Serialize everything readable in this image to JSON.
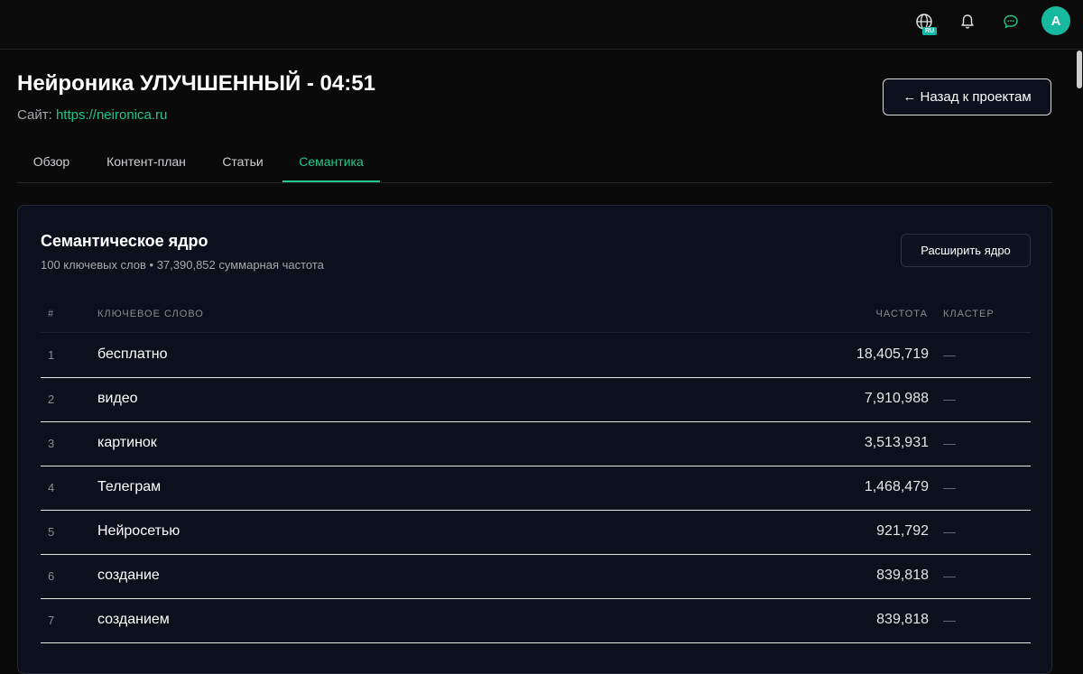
{
  "header": {
    "language_badge": "RU",
    "avatar_letter": "A",
    "icons": [
      "globe-icon",
      "bell-icon",
      "chat-icon"
    ],
    "accent_color": "#22c58b"
  },
  "project": {
    "title": "Нейроника УЛУЧШЕННЫЙ - 04:51",
    "site_label": "Сайт:",
    "site_url": "https://neironica.ru",
    "back_button": "← Назад к проектам"
  },
  "tabs": [
    {
      "label": "Обзор",
      "active": false
    },
    {
      "label": "Контент-план",
      "active": false
    },
    {
      "label": "Статьи",
      "active": false
    },
    {
      "label": "Семантика",
      "active": true
    }
  ],
  "semantics": {
    "title": "Семантическое ядро",
    "subtitle": "100 ключевых слов • 37,390,852 суммарная частота",
    "expand_button": "Расширить ядро",
    "columns": {
      "number": "#",
      "keyword": "КЛЮЧЕВОЕ СЛОВО",
      "frequency": "ЧАСТОТА",
      "cluster": "КЛАСТЕР"
    },
    "rows": [
      {
        "n": "1",
        "keyword": "бесплатно",
        "frequency": "18,405,719",
        "cluster": "—"
      },
      {
        "n": "2",
        "keyword": "видео",
        "frequency": "7,910,988",
        "cluster": "—"
      },
      {
        "n": "3",
        "keyword": "картинок",
        "frequency": "3,513,931",
        "cluster": "—"
      },
      {
        "n": "4",
        "keyword": "Телеграм",
        "frequency": "1,468,479",
        "cluster": "—"
      },
      {
        "n": "5",
        "keyword": "Нейросетью",
        "frequency": "921,792",
        "cluster": "—"
      },
      {
        "n": "6",
        "keyword": "создание",
        "frequency": "839,818",
        "cluster": "—"
      },
      {
        "n": "7",
        "keyword": "созданием",
        "frequency": "839,818",
        "cluster": "—"
      }
    ]
  }
}
